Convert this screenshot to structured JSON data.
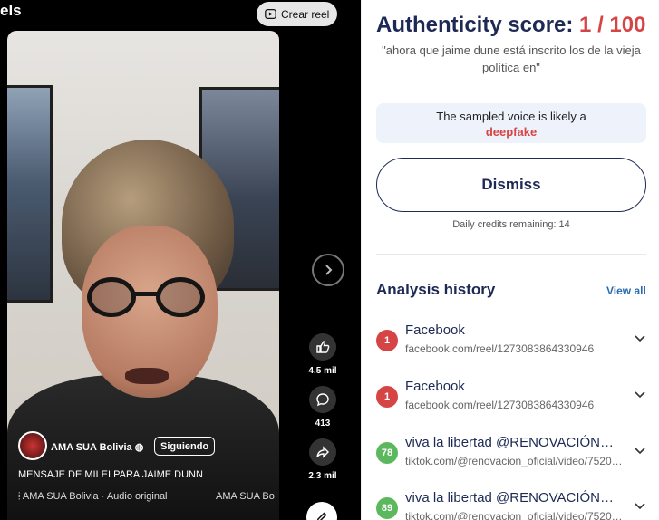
{
  "reels": {
    "title": "els",
    "create_button_label": "Crear reel",
    "author": "AMA SUA Bolivia",
    "follow_label": "Siguiendo",
    "caption": "MENSAJE DE MILEI PARA JAIME DUNN",
    "audio_text": "AMA SUA Bolivia · Audio original",
    "audio_text_2": "AMA SUA Bo",
    "likes": "4.5 mil",
    "comments": "413",
    "shares": "2.3 mil"
  },
  "panel": {
    "score_label": "Authenticity score:",
    "score_value": "1 / 100",
    "quote": "\"ahora que jaime dune está inscrito los de la vieja política en\"",
    "verdict_text": "The sampled voice is likely a",
    "verdict_word": "deepfake",
    "dismiss_label": "Dismiss",
    "credits": "Daily credits remaining: 14",
    "history_title": "Analysis history",
    "view_all_label": "View all",
    "history": [
      {
        "score": "1",
        "level": "red",
        "title": "Facebook",
        "url": "facebook.com/reel/1273083864330946"
      },
      {
        "score": "1",
        "level": "red",
        "title": "Facebook",
        "url": "facebook.com/reel/1273083864330946"
      },
      {
        "score": "78",
        "level": "green",
        "title": "viva la libertad @RENOVACIÓN…",
        "url": "tiktok.com/@renovacion_oficial/video/7520…"
      },
      {
        "score": "89",
        "level": "green",
        "title": "viva la libertad @RENOVACIÓN…",
        "url": "tiktok.com/@renovacion_oficial/video/7520…"
      }
    ]
  },
  "colors": {
    "accent_red": "#d64545",
    "accent_green": "#5cb85c",
    "navy": "#1d2a55",
    "link_blue": "#2b6cb0"
  }
}
